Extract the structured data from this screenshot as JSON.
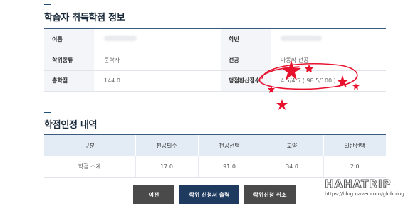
{
  "section1": {
    "title": "학습자 취득학점 정보",
    "rows": [
      {
        "label_left": "이름",
        "label_right": "학번"
      },
      {
        "label_left": "학위종류",
        "value_left": "문학사",
        "label_right": "전공",
        "value_right": "아동학 전공"
      },
      {
        "label_left": "총학점",
        "value_left": "144.0",
        "label_right": "평점환산점수",
        "value_right": "4.5/4.5 ( 98.5/100 )"
      }
    ]
  },
  "section2": {
    "title": "학점인정 내역",
    "headers": [
      "구분",
      "전공필수",
      "전공선택",
      "교양",
      "일반선택"
    ],
    "row": [
      "학점 소계",
      "17.0",
      "91.0",
      "34.0",
      "2.0"
    ]
  },
  "buttons": {
    "prev": "이전",
    "print": "학위 신청서 출력",
    "cancel": "학위신청 취소"
  },
  "watermark": {
    "title": "HAHATRIP",
    "url": "https://blog.naver.com/globping"
  },
  "colors": {
    "accent": "#1f4e79",
    "navy_button": "#1e3a5f",
    "dark_button": "#4a4a4a",
    "header_bg": "#e3ebf4",
    "annotation": "#e8112d"
  }
}
